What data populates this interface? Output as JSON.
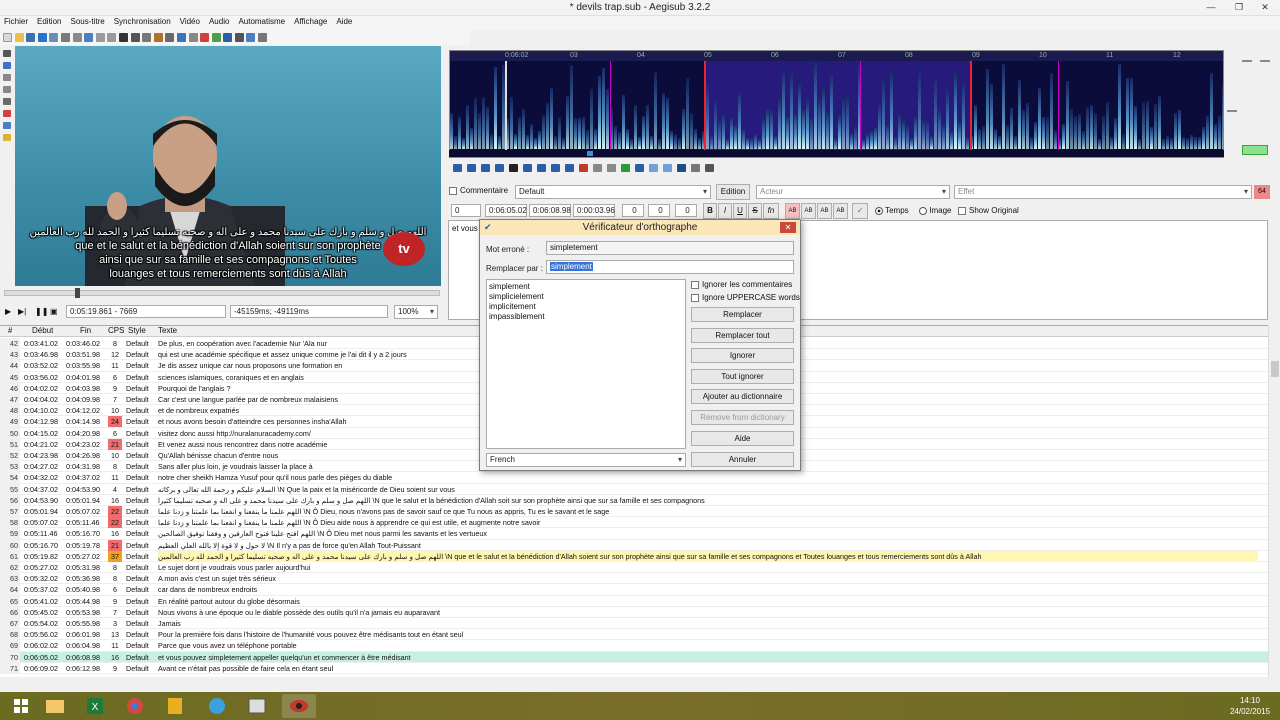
{
  "window": {
    "title": "* devils trap.sub - Aegisub 3.2.2"
  },
  "menu": [
    "Fichier",
    "Edition",
    "Sous-titre",
    "Synchronisation",
    "Vidéo",
    "Audio",
    "Automatisme",
    "Affichage",
    "Aide"
  ],
  "video": {
    "subtitle_arabic": "اللهم صل و سلم و بارك على سيدنا محمد و على اله و صحبه تسليما كثيرا و الحمد لله رب العالمين",
    "subtitle_line1": "que et le salut et la bénédiction d'Allah soient sur son prophète",
    "subtitle_line2": "ainsi que sur sa famille et ses compagnons et Toutes",
    "subtitle_line3": "louanges et tous remerciements sont dûs à Allah",
    "logo_text": "tv",
    "time_field": "0:05:19.861 - 7669",
    "offset_field": "-45159ms; -49119ms",
    "zoom": "100%",
    "progress": 0.16
  },
  "audio": {
    "ruler_labels": [
      "0:06:02",
      "03",
      "04",
      "05",
      "06",
      "07",
      "08",
      "09",
      "10",
      "11",
      "12"
    ]
  },
  "editbox": {
    "comment_label": "Commentaire",
    "style": "Default",
    "edit_button": "Edition",
    "actor_placeholder": "Acteur",
    "effect_placeholder": "Effet",
    "effect_count": "64",
    "layer": "0",
    "start_time": "0:06:05.02",
    "end_time": "0:06:08.98",
    "duration": "0:00:03.96",
    "margin_l": "0",
    "margin_r": "0",
    "margin_v": "0",
    "fmt_bold": "B",
    "fmt_italic": "I",
    "fmt_underline": "U",
    "fmt_strike": "S",
    "fmt_fn": "fn",
    "fmt_ab1": "AB",
    "fmt_ab2": "AB",
    "fmt_ab3": "AB",
    "fmt_ab4": "AB",
    "radio_time": "Temps",
    "radio_frame": "Image",
    "show_original": "Show Original",
    "text_value": "et vous"
  },
  "spellcheck": {
    "title": "Vérificateur d'orthographe",
    "misspelled_label": "Mot erroné :",
    "misspelled_value": "simpletement",
    "replace_label": "Remplacer par :",
    "replace_value": "simplement",
    "suggestions": [
      "simplement",
      "simplicielement",
      "implicitement",
      "impassiblement"
    ],
    "ignore_comments": "Ignorer les commentaires",
    "ignore_upper": "Ignore UPPERCASE words",
    "btn_replace": "Remplacer",
    "btn_replace_all": "Remplacer tout",
    "btn_ignore": "Ignorer",
    "btn_ignore_all": "Tout ignorer",
    "btn_add_dict": "Ajouter au dictionnaire",
    "btn_remove_dict": "Remove from dictionary",
    "btn_help": "Aide",
    "btn_cancel": "Annuler",
    "language": "French"
  },
  "grid": {
    "headers": {
      "num": "#",
      "start": "Début",
      "end": "Fin",
      "cps": "CPS",
      "style": "Style",
      "text": "Texte"
    },
    "rows": [
      {
        "n": "42",
        "s": "0:03:41.02",
        "e": "0:03:46.02",
        "c": "8",
        "st": "Default",
        "t": "De plus, en coopération avec l'academie Nur 'Ala nur"
      },
      {
        "n": "43",
        "s": "0:03:46.98",
        "e": "0:03:51.98",
        "c": "12",
        "st": "Default",
        "t": "qui est une académie spécifique et assez unique comme je l'ai dit il y a 2 jours"
      },
      {
        "n": "44",
        "s": "0:03:52.02",
        "e": "0:03:55.98",
        "c": "11",
        "st": "Default",
        "t": "Je dis assez unique car nous proposons une formation en"
      },
      {
        "n": "45",
        "s": "0:03:56.02",
        "e": "0:04:01.98",
        "c": "6",
        "st": "Default",
        "t": "sciences islamiques, coraniques et en anglais"
      },
      {
        "n": "46",
        "s": "0:04:02.02",
        "e": "0:04:03.98",
        "c": "9",
        "st": "Default",
        "t": "Pourquoi de l'anglais ?"
      },
      {
        "n": "47",
        "s": "0:04:04.02",
        "e": "0:04:09.98",
        "c": "7",
        "st": "Default",
        "t": "Car c'est une langue parlée par de nombreux malaisiens"
      },
      {
        "n": "48",
        "s": "0:04:10.02",
        "e": "0:04:12.02",
        "c": "10",
        "st": "Default",
        "t": "et de nombreux expatriés"
      },
      {
        "n": "49",
        "s": "0:04:12.98",
        "e": "0:04:14.98",
        "c": "24",
        "st": "Default",
        "t": "et nous avons besoin d'atteindre ces personnes insha'Allah",
        "hl": "red"
      },
      {
        "n": "50",
        "s": "0:04:15.02",
        "e": "0:04:20.98",
        "c": "6",
        "st": "Default",
        "t": "visitez donc aussi http://nuralanuracademy.com/"
      },
      {
        "n": "51",
        "s": "0:04:21.02",
        "e": "0:04:23.02",
        "c": "21",
        "st": "Default",
        "t": "Et venez aussi nous rencontrez dans notre académie",
        "hl": "red"
      },
      {
        "n": "52",
        "s": "0:04:23.98",
        "e": "0:04:26.98",
        "c": "10",
        "st": "Default",
        "t": "Qu'Allah bénisse chacun d'entre nous"
      },
      {
        "n": "53",
        "s": "0:04:27.02",
        "e": "0:04:31.98",
        "c": "8",
        "st": "Default",
        "t": "Sans aller plus loin, je voudrais laisser la place à"
      },
      {
        "n": "54",
        "s": "0:04:32.02",
        "e": "0:04:37.02",
        "c": "11",
        "st": "Default",
        "t": "notre cher sheikh Hamza Yusuf pour qu'il nous parle des pièges du diable"
      },
      {
        "n": "55",
        "s": "0:04:37.02",
        "e": "0:04:53.90",
        "c": "4",
        "st": "Default",
        "t": "السلام عليكم و رحمة الله تعالى و بركاته \\N Que la paix et la miséricorde de Dieu soient sur vous"
      },
      {
        "n": "56",
        "s": "0:04:53.90",
        "e": "0:05:01.94",
        "c": "16",
        "st": "Default",
        "t": "اللهم صل و سلم و بارك على سيدنا محمد و على اله و صحبه تسليما كثيرا \\N que le salut et la bénédiction d'Allah soit sur son prophète ainsi que sur sa famille et ses compagnons"
      },
      {
        "n": "57",
        "s": "0:05:01.94",
        "e": "0:05:07.02",
        "c": "22",
        "st": "Default",
        "t": "اللهم علمنا ما ينفعنا و انفعنا بما علمتنا و زدنا علما \\N Ô Dieu, nous n'avons pas de savoir sauf ce que Tu nous as appris, Tu es le savant et le sage",
        "hl": "red"
      },
      {
        "n": "58",
        "s": "0:05:07.02",
        "e": "0:05:11.46",
        "c": "22",
        "st": "Default",
        "t": "اللهم علمنا ما ينفعنا و انفعنا بما علمتنا و زدنا علما \\N Ô Dieu aide nous à apprendre ce qui est utile, et augmente notre savoir",
        "hl": "red"
      },
      {
        "n": "59",
        "s": "0:05:11.46",
        "e": "0:05:16.70",
        "c": "16",
        "st": "Default",
        "t": "اللهم افتح علينا فتوح العارفين و وفقنا توفيق الصالحين \\N Ô Dieu met nous parmi les savants et les vertueux"
      },
      {
        "n": "60",
        "s": "0:05:16.70",
        "e": "0:05:19.78",
        "c": "21",
        "st": "Default",
        "t": "لا حول و لا قوة إلا بالله العلي العظيم \\N Il n'y a pas de force qu'en Allah Tout-Puissant",
        "hl": "red"
      },
      {
        "n": "61",
        "s": "0:05:19.82",
        "e": "0:05:27.02",
        "c": "37",
        "st": "Default",
        "t": "اللهم صل و سلم و بارك على سيدنا محمد و على اله و صحبه تسليما كثيرا و الحمد لله رب العالمين \\N que et le salut et la bénédiction d'Allah soient sur son prophète ainsi que sur sa famille et ses compagnons et Toutes louanges et tous remerciements sont dûs à Allah",
        "hl": "yellow"
      },
      {
        "n": "62",
        "s": "0:05:27.02",
        "e": "0:05:31.98",
        "c": "8",
        "st": "Default",
        "t": "Le sujet dont je voudrais vous parler aujourd'hui"
      },
      {
        "n": "63",
        "s": "0:05:32.02",
        "e": "0:05:36.98",
        "c": "8",
        "st": "Default",
        "t": "A mon avis c'est un sujet très sérieux"
      },
      {
        "n": "64",
        "s": "0:05:37.02",
        "e": "0:05:40.98",
        "c": "6",
        "st": "Default",
        "t": "car dans de nombreux endroits"
      },
      {
        "n": "65",
        "s": "0:05:41.02",
        "e": "0:05:44.98",
        "c": "9",
        "st": "Default",
        "t": "En réalité partout autour du globe désormais"
      },
      {
        "n": "66",
        "s": "0:05:45.02",
        "e": "0:05:53.98",
        "c": "7",
        "st": "Default",
        "t": "Nous vivons à une époque ou le diable possède des outils qu'il n'a jamais eu auparavant"
      },
      {
        "n": "67",
        "s": "0:05:54.02",
        "e": "0:05:55.98",
        "c": "3",
        "st": "Default",
        "t": "Jamais"
      },
      {
        "n": "68",
        "s": "0:05:56.02",
        "e": "0:06:01.98",
        "c": "13",
        "st": "Default",
        "t": "Pour la première fois dans l'histoire de l'humanité vous pouvez être médisants tout en étant seul"
      },
      {
        "n": "69",
        "s": "0:06:02.02",
        "e": "0:06:04.98",
        "c": "11",
        "st": "Default",
        "t": "Parce que vous avez un téléphone portable"
      },
      {
        "n": "70",
        "s": "0:06:05.02",
        "e": "0:06:08.98",
        "c": "16",
        "st": "Default",
        "t": "et vous pouvez simpletement appeller quelqu'un et commencer à être médisant",
        "hl": "sel"
      },
      {
        "n": "71",
        "s": "0:06:09.02",
        "e": "0:06:12.98",
        "c": "9",
        "st": "Default",
        "t": "Avant ce n'était pas possible de faire cela en étant seul"
      }
    ]
  },
  "taskbar": {
    "time": "14:10",
    "date": "24/02/2015"
  },
  "colors": {
    "cps_warn": "#f06b6b",
    "cps_high": "#f0a020",
    "selected_row": "#c8f0e0",
    "dialog_title": "#fbe6b8"
  }
}
